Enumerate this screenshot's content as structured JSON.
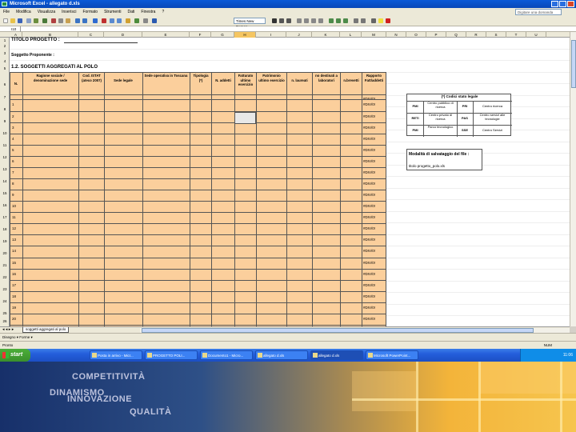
{
  "window": {
    "title": "Microsoft Excel - allegato d.xls"
  },
  "menu": [
    "File",
    "Modifica",
    "Visualizza",
    "Inserisci",
    "Formato",
    "Strumenti",
    "Dati",
    "Finestra",
    "?"
  ],
  "help_placeholder": "Digitare una domanda",
  "toolbar": {
    "font": "Times New Roman"
  },
  "name_box": "I10",
  "columns": [
    "A",
    "B",
    "C",
    "D",
    "E",
    "F",
    "G",
    "H",
    "I",
    "J",
    "K",
    "L",
    "M",
    "N",
    "O",
    "P",
    "Q",
    "R",
    "S",
    "T",
    "U"
  ],
  "rows": [
    "1",
    "2",
    "3",
    "4",
    "5",
    "6",
    "7",
    "8",
    "9",
    "10",
    "11",
    "12",
    "13",
    "14",
    "15",
    "16",
    "17",
    "18",
    "19",
    "20",
    "21",
    "22",
    "23",
    "24",
    "25",
    "26",
    "27"
  ],
  "sheet": {
    "title": "TITOLO PROGETTO :",
    "proponent": "Soggetto Proponente :",
    "section": "1.2. SOGGETTI AGGREGATI AL POLO",
    "headers": [
      "N.",
      "Ragione sociale / denominazione sede",
      "Cod. ISTAT (ateco 2007)",
      "Sede legale",
      "Sede operativa in Toscana",
      "Tipologia (*)",
      "N. addetti",
      "Fatturato ultimo esercizio",
      "Patrimonio ultimo esercizio",
      "n. laureati",
      "no destinati a laboratori",
      "n.brevetti",
      "Rapporto Fatt/addetti"
    ],
    "row_numbers": [
      "1",
      "2",
      "3",
      "4",
      "5",
      "6",
      "7",
      "8",
      "9",
      "10",
      "11",
      "12",
      "13",
      "14",
      "15",
      "16",
      "17",
      "18",
      "19",
      "20",
      "21"
    ],
    "error_value": "#DIV/0!",
    "legend": {
      "title": "(*) Codici stato legale",
      "cells": [
        [
          "PMI",
          "Centro pubblico di ricerca",
          "PRI",
          "Centro ricerca"
        ],
        [
          "RETI",
          "Centro privato di ricerca",
          "PAS",
          "Centro servizi alle tecnologie"
        ],
        [
          "PMI",
          "Parco tecnologico",
          "SSE",
          "Centro Servizi"
        ]
      ]
    },
    "save": {
      "title": "Modalità di salvataggio del file :",
      "value": "titolo progetto_polo.xls"
    },
    "tab": "soggetti aggregati al polo"
  },
  "drawbar": "Disegno ▾   Forme ▾",
  "status": {
    "left": "Pronto",
    "right": "NUM"
  },
  "taskbar": {
    "start": "start",
    "tasks": [
      "Posta in arrivo - Micr...",
      "PROGETTO POLI...",
      "Documento1 - Micro...",
      "allegato d.xls",
      "Microsoft PowerPoint..."
    ],
    "clock": "11:06"
  },
  "slide": {
    "words": [
      "COMPETITIVITÀ",
      "DINAMISMO",
      "INNOVAZIONE",
      "QUALITÀ"
    ]
  }
}
